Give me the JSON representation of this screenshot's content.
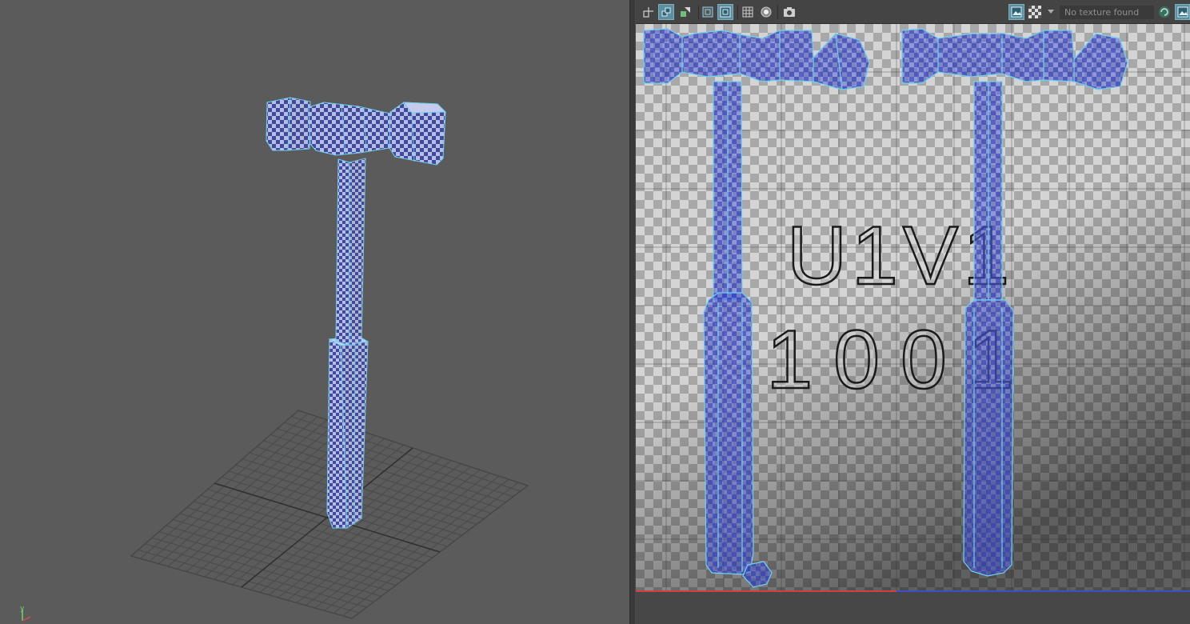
{
  "toolbar": {
    "texture_status": "No texture found",
    "icons": [
      "grid-toggle-icon",
      "uv-shell-icon",
      "uv-shading-icon",
      "frame-selection-icon",
      "frame-all-icon",
      "pixel-snap-icon",
      "display-options-icon",
      "snapshot-icon",
      "image-display-icon",
      "checker-map-icon",
      "dropdown-arrow-icon",
      "refresh-icon",
      "image-toggle-icon"
    ]
  },
  "uv_labels": {
    "tile_name": "U1V1",
    "udim": "1001"
  },
  "axes": {
    "y_axis_label": "y"
  },
  "colors": {
    "wire": "#6fd2ef",
    "uv_blue": "#3e4fc8",
    "viewport_bg": "#5b5b5b",
    "toolbar_active": "#5e8fa0"
  }
}
